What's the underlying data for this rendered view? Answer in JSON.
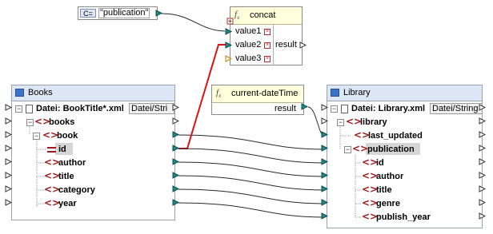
{
  "constant": {
    "tag": "C=",
    "value": "\"publication\""
  },
  "concat": {
    "name": "concat",
    "inputs": [
      "value1",
      "value2",
      "value3"
    ],
    "output": "result"
  },
  "current_datetime": {
    "name": "current-dateTime",
    "output": "result"
  },
  "books": {
    "title": "Books",
    "file_label": "Datei: BookTitle*.xml",
    "file_button": "Datei/Stri",
    "root": "books",
    "element": "book",
    "fields": [
      "id",
      "author",
      "title",
      "category",
      "year"
    ]
  },
  "library": {
    "title": "Library",
    "file_label": "Datei: Library.xml",
    "file_button": "Datei/String",
    "root": "library",
    "children": [
      "last_updated",
      "publication"
    ],
    "fields": [
      "id",
      "author",
      "title",
      "genre",
      "publish_year"
    ]
  },
  "colors": {
    "connector": "#2a2a2a",
    "selected_connector": "#e01010",
    "port_fill": "#1f8a8a"
  }
}
